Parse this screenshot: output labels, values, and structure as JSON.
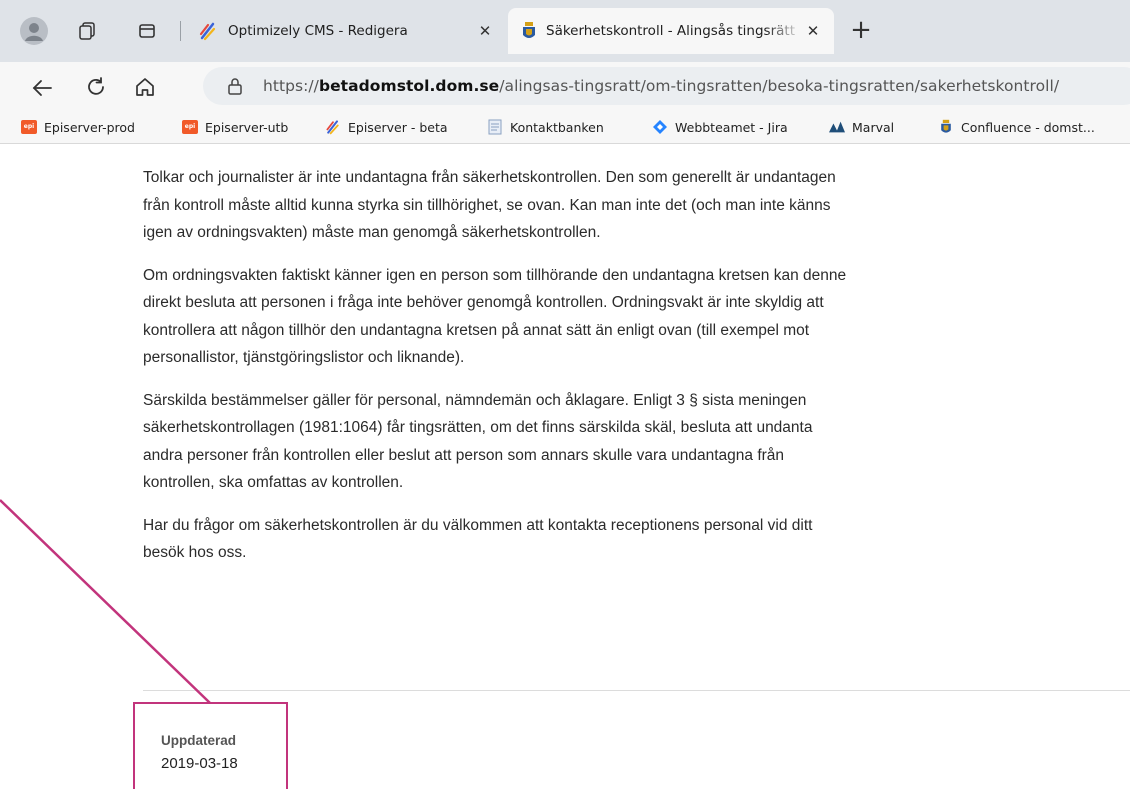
{
  "browser": {
    "tabs": [
      {
        "title": "Optimizely CMS - Redigera",
        "active": false
      },
      {
        "title": "Säkerhetskontroll - Alingsås tingsrätt",
        "active": true
      }
    ],
    "close_glyph": "✕",
    "new_tab_glyph": "+",
    "url": {
      "scheme": "https://",
      "host": "betadomstol.dom.se",
      "path": "/alingsas-tingsratt/om-tingsratten/besoka-tingsratten/sakerhetskontroll/"
    },
    "bookmarks": [
      {
        "label": "Episerver-prod",
        "icon": "episerver-icon"
      },
      {
        "label": "Episerver-utb",
        "icon": "episerver-icon"
      },
      {
        "label": "Episerver - beta",
        "icon": "optimizely-icon"
      },
      {
        "label": "Kontaktbanken",
        "icon": "document-icon"
      },
      {
        "label": "Webbteamet - Jira",
        "icon": "jira-icon"
      },
      {
        "label": "Marval",
        "icon": "marval-icon"
      },
      {
        "label": "Confluence - domst...",
        "icon": "crest-icon"
      }
    ]
  },
  "page": {
    "paragraphs": [
      "Tolkar och journalister är inte undantagna från säkerhetskontrollen. Den som generellt är undantagen från kontroll måste alltid kunna styrka sin tillhörighet, se ovan. Kan man inte det (och man inte känns igen av ordningsvakten) måste man genomgå säkerhetskontrollen.",
      "Om ordningsvakten faktiskt känner igen en person som tillhörande den undantagna kretsen kan denne direkt besluta att personen i fråga inte behöver genomgå kontrollen. Ordningsvakt är inte skyldig att kontrollera att någon tillhör den undantagna kretsen på annat sätt än enligt ovan (till exempel mot personallistor, tjänstgöringslistor och liknande).",
      "Särskilda bestämmelser gäller för personal, nämndemän och åklagare. Enligt 3 § sista meningen säkerhetskontrollagen (1981:1064) får tingsrätten, om det finns särskilda skäl, besluta att undanta andra personer från kontrollen eller beslut att person som annars skulle vara undantagna från kontrollen, ska omfattas av kontrollen.",
      "Har du frågor om säkerhetskontrollen är du välkommen att kontakta receptionens personal vid ditt besök hos oss."
    ],
    "updated_label": "Uppdaterad",
    "updated_date": "2019-03-18"
  },
  "colors": {
    "annotation": "#c2347c",
    "tabstrip": "#dfe3e8",
    "toolbar": "#f7f7f7"
  }
}
